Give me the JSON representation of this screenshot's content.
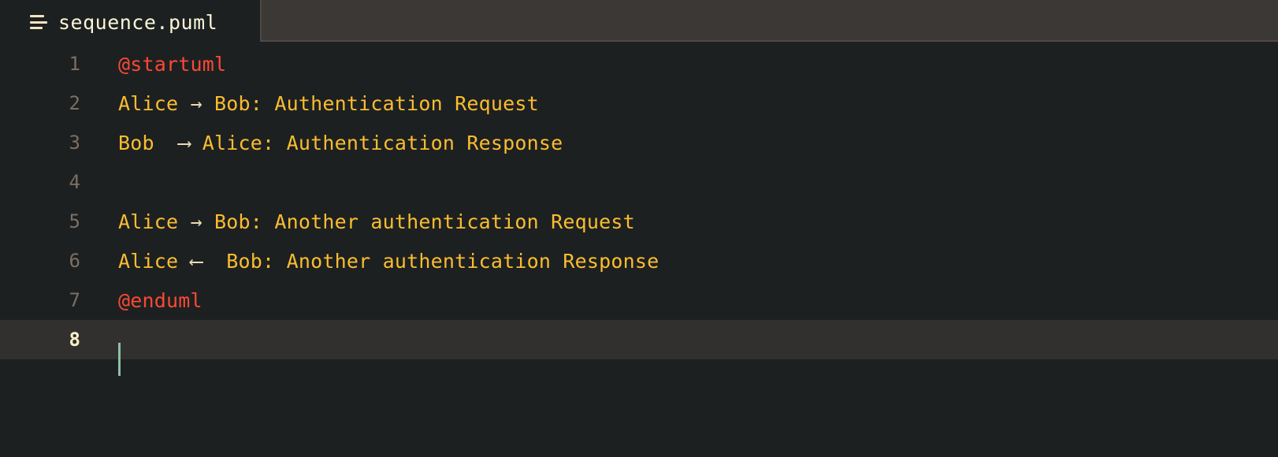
{
  "window": {
    "background_color": "#1d2021",
    "active_line_color": "#32302f",
    "caret_color": "#8ec0a8"
  },
  "tabbar": {
    "active_tab": {
      "title": "sequence.puml",
      "icon": "lines-file-icon"
    }
  },
  "editor": {
    "language": "plantuml",
    "active_line": 8,
    "colors": {
      "keyword": "#fb4934",
      "identifier": "#fabd2f",
      "arrow": "#ebdbb2",
      "message": "#fabd2f",
      "line_number": "#7c6f64",
      "line_number_active": "#fbf1c7"
    },
    "lines": [
      {
        "number": "1",
        "tokens": [
          {
            "type": "keyword",
            "text": "@startuml"
          }
        ]
      },
      {
        "number": "2",
        "tokens": [
          {
            "type": "ident",
            "text": "Alice "
          },
          {
            "type": "arrow",
            "text": "→"
          },
          {
            "type": "ident",
            "text": " Bob"
          },
          {
            "type": "punct",
            "text": ":"
          },
          {
            "type": "msg",
            "text": " Authentication Request"
          }
        ]
      },
      {
        "number": "3",
        "tokens": [
          {
            "type": "ident",
            "text": "Bob  "
          },
          {
            "type": "arrow",
            "text": "⟶"
          },
          {
            "type": "ident",
            "text": " Alice"
          },
          {
            "type": "punct",
            "text": ":"
          },
          {
            "type": "msg",
            "text": " Authentication Response"
          }
        ]
      },
      {
        "number": "4",
        "tokens": []
      },
      {
        "number": "5",
        "tokens": [
          {
            "type": "ident",
            "text": "Alice "
          },
          {
            "type": "arrow",
            "text": "→"
          },
          {
            "type": "ident",
            "text": " Bob"
          },
          {
            "type": "punct",
            "text": ":"
          },
          {
            "type": "msg",
            "text": " Another authentication Request"
          }
        ]
      },
      {
        "number": "6",
        "tokens": [
          {
            "type": "ident",
            "text": "Alice "
          },
          {
            "type": "arrow",
            "text": "⟵"
          },
          {
            "type": "ident",
            "text": "  Bob"
          },
          {
            "type": "punct",
            "text": ":"
          },
          {
            "type": "msg",
            "text": " Another authentication Response"
          }
        ]
      },
      {
        "number": "7",
        "tokens": [
          {
            "type": "keyword",
            "text": "@enduml"
          }
        ]
      },
      {
        "number": "8",
        "tokens": [],
        "has_caret": true
      }
    ]
  }
}
